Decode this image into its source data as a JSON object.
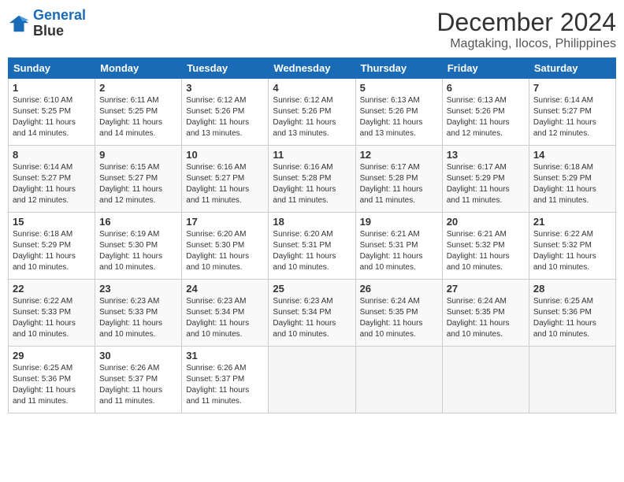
{
  "logo": {
    "line1": "General",
    "line2": "Blue"
  },
  "title": "December 2024",
  "location": "Magtaking, Ilocos, Philippines",
  "days_header": [
    "Sunday",
    "Monday",
    "Tuesday",
    "Wednesday",
    "Thursday",
    "Friday",
    "Saturday"
  ],
  "weeks": [
    [
      {
        "num": "1",
        "sunrise": "6:10 AM",
        "sunset": "5:25 PM",
        "daylight": "11 hours and 14 minutes."
      },
      {
        "num": "2",
        "sunrise": "6:11 AM",
        "sunset": "5:25 PM",
        "daylight": "11 hours and 14 minutes."
      },
      {
        "num": "3",
        "sunrise": "6:12 AM",
        "sunset": "5:26 PM",
        "daylight": "11 hours and 13 minutes."
      },
      {
        "num": "4",
        "sunrise": "6:12 AM",
        "sunset": "5:26 PM",
        "daylight": "11 hours and 13 minutes."
      },
      {
        "num": "5",
        "sunrise": "6:13 AM",
        "sunset": "5:26 PM",
        "daylight": "11 hours and 13 minutes."
      },
      {
        "num": "6",
        "sunrise": "6:13 AM",
        "sunset": "5:26 PM",
        "daylight": "11 hours and 12 minutes."
      },
      {
        "num": "7",
        "sunrise": "6:14 AM",
        "sunset": "5:27 PM",
        "daylight": "11 hours and 12 minutes."
      }
    ],
    [
      {
        "num": "8",
        "sunrise": "6:14 AM",
        "sunset": "5:27 PM",
        "daylight": "11 hours and 12 minutes."
      },
      {
        "num": "9",
        "sunrise": "6:15 AM",
        "sunset": "5:27 PM",
        "daylight": "11 hours and 12 minutes."
      },
      {
        "num": "10",
        "sunrise": "6:16 AM",
        "sunset": "5:27 PM",
        "daylight": "11 hours and 11 minutes."
      },
      {
        "num": "11",
        "sunrise": "6:16 AM",
        "sunset": "5:28 PM",
        "daylight": "11 hours and 11 minutes."
      },
      {
        "num": "12",
        "sunrise": "6:17 AM",
        "sunset": "5:28 PM",
        "daylight": "11 hours and 11 minutes."
      },
      {
        "num": "13",
        "sunrise": "6:17 AM",
        "sunset": "5:29 PM",
        "daylight": "11 hours and 11 minutes."
      },
      {
        "num": "14",
        "sunrise": "6:18 AM",
        "sunset": "5:29 PM",
        "daylight": "11 hours and 11 minutes."
      }
    ],
    [
      {
        "num": "15",
        "sunrise": "6:18 AM",
        "sunset": "5:29 PM",
        "daylight": "11 hours and 10 minutes."
      },
      {
        "num": "16",
        "sunrise": "6:19 AM",
        "sunset": "5:30 PM",
        "daylight": "11 hours and 10 minutes."
      },
      {
        "num": "17",
        "sunrise": "6:20 AM",
        "sunset": "5:30 PM",
        "daylight": "11 hours and 10 minutes."
      },
      {
        "num": "18",
        "sunrise": "6:20 AM",
        "sunset": "5:31 PM",
        "daylight": "11 hours and 10 minutes."
      },
      {
        "num": "19",
        "sunrise": "6:21 AM",
        "sunset": "5:31 PM",
        "daylight": "11 hours and 10 minutes."
      },
      {
        "num": "20",
        "sunrise": "6:21 AM",
        "sunset": "5:32 PM",
        "daylight": "11 hours and 10 minutes."
      },
      {
        "num": "21",
        "sunrise": "6:22 AM",
        "sunset": "5:32 PM",
        "daylight": "11 hours and 10 minutes."
      }
    ],
    [
      {
        "num": "22",
        "sunrise": "6:22 AM",
        "sunset": "5:33 PM",
        "daylight": "11 hours and 10 minutes."
      },
      {
        "num": "23",
        "sunrise": "6:23 AM",
        "sunset": "5:33 PM",
        "daylight": "11 hours and 10 minutes."
      },
      {
        "num": "24",
        "sunrise": "6:23 AM",
        "sunset": "5:34 PM",
        "daylight": "11 hours and 10 minutes."
      },
      {
        "num": "25",
        "sunrise": "6:23 AM",
        "sunset": "5:34 PM",
        "daylight": "11 hours and 10 minutes."
      },
      {
        "num": "26",
        "sunrise": "6:24 AM",
        "sunset": "5:35 PM",
        "daylight": "11 hours and 10 minutes."
      },
      {
        "num": "27",
        "sunrise": "6:24 AM",
        "sunset": "5:35 PM",
        "daylight": "11 hours and 10 minutes."
      },
      {
        "num": "28",
        "sunrise": "6:25 AM",
        "sunset": "5:36 PM",
        "daylight": "11 hours and 10 minutes."
      }
    ],
    [
      {
        "num": "29",
        "sunrise": "6:25 AM",
        "sunset": "5:36 PM",
        "daylight": "11 hours and 11 minutes."
      },
      {
        "num": "30",
        "sunrise": "6:26 AM",
        "sunset": "5:37 PM",
        "daylight": "11 hours and 11 minutes."
      },
      {
        "num": "31",
        "sunrise": "6:26 AM",
        "sunset": "5:37 PM",
        "daylight": "11 hours and 11 minutes."
      },
      null,
      null,
      null,
      null
    ]
  ],
  "labels": {
    "sunrise": "Sunrise:",
    "sunset": "Sunset:",
    "daylight": "Daylight:"
  }
}
